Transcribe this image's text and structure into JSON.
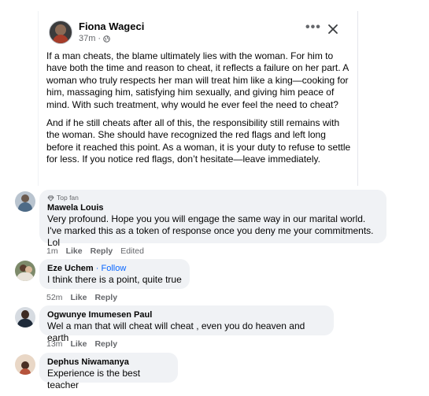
{
  "post": {
    "author": "Fiona Wageci",
    "time": "37m",
    "paragraphs": [
      "If a man cheats, the blame ultimately lies with the woman. For him to have both the time and reason to cheat, it reflects a failure on her part. A woman who truly respects her man will treat him like a king—cooking for him, massaging him, satisfying him sexually, and giving him peace of mind. With such treatment, why would he ever feel the need to cheat?",
      "And if he still cheats after all of this, the responsibility still remains with the woman. She should have recognized the red flags and left long before it reached this point. As a woman, it is your duty to refuse to settle for less. If you notice red flags, don’t hesitate—leave immediately."
    ],
    "icons": {
      "more": "more-dots-icon",
      "close": "close-icon",
      "audience": "globe-icon"
    }
  },
  "comments": [
    {
      "badge": "Top fan",
      "name": "Mawela Louis",
      "text": "Very profound. Hope you you will engage the same way in our marital world. I've marked this as a token of response once you deny me your commitments. Lol",
      "time": "1m",
      "like": "Like",
      "reply": "Reply",
      "edited": "Edited"
    },
    {
      "name": "Eze Uchem",
      "follow": "Follow",
      "text": "I think there is a point, quite true",
      "time": "52m",
      "like": "Like",
      "reply": "Reply"
    },
    {
      "name": "Ogwunye Imumesen Paul",
      "text": "Wel a man that will cheat will cheat , even you do heaven and earth",
      "time": "13m",
      "like": "Like",
      "reply": "Reply"
    },
    {
      "name": "Dephus Niwamanya",
      "text": "Experience is the best teacher"
    }
  ],
  "colors": {
    "bubble": "#f0f2f5",
    "link": "#0866ff",
    "muted": "#65676b",
    "text": "#050505"
  }
}
